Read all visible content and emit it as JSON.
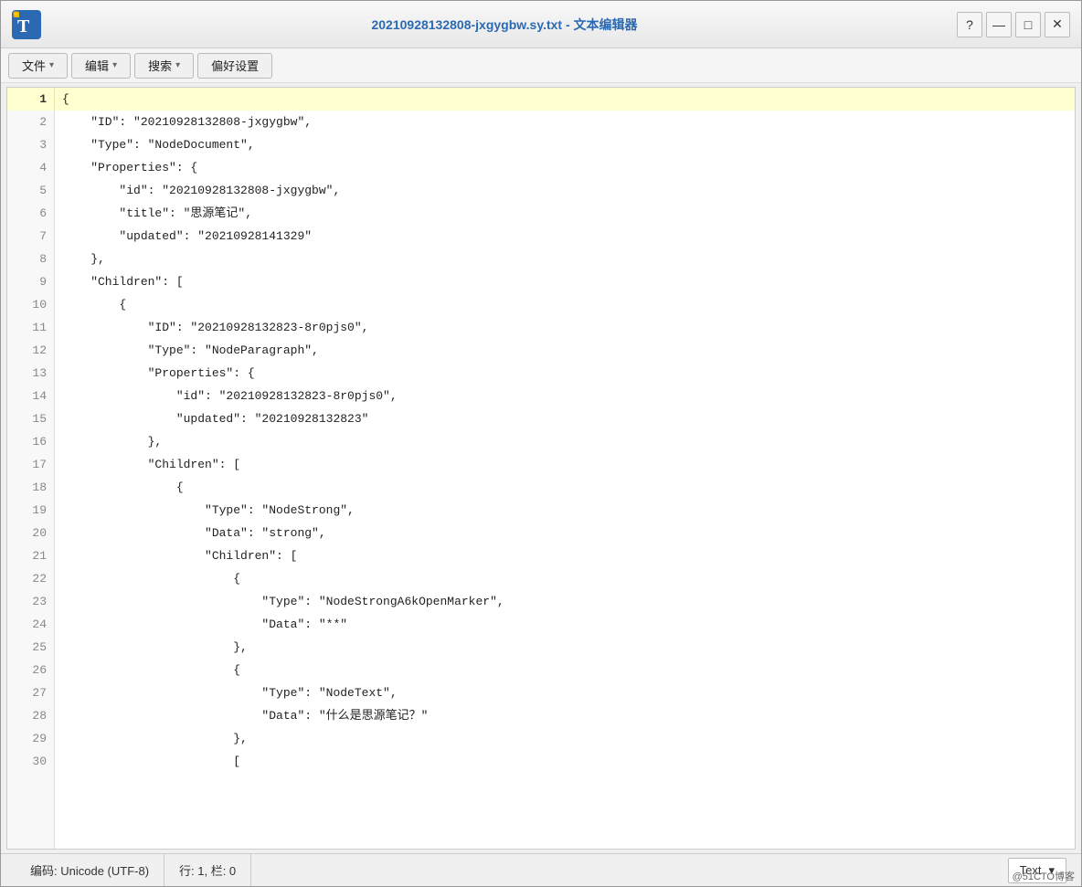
{
  "window": {
    "title": "20210928132808-jxgygbw.sy.txt - 文本编辑器",
    "icon_label": "T"
  },
  "title_controls": {
    "help": "?",
    "minimize": "—",
    "maximize": "□",
    "close": "✕"
  },
  "menu": {
    "file_label": "文件",
    "file_arrow": "▾",
    "edit_label": "编辑",
    "edit_arrow": "▾",
    "search_label": "搜索",
    "search_arrow": "▾",
    "preferences_label": "偏好设置"
  },
  "lines": [
    {
      "num": 1,
      "active": true,
      "text": "{"
    },
    {
      "num": 2,
      "active": false,
      "text": "    \"ID\": \"20210928132808-jxgygbw\","
    },
    {
      "num": 3,
      "active": false,
      "text": "    \"Type\": \"NodeDocument\","
    },
    {
      "num": 4,
      "active": false,
      "text": "    \"Properties\": {"
    },
    {
      "num": 5,
      "active": false,
      "text": "        \"id\": \"20210928132808-jxgygbw\","
    },
    {
      "num": 6,
      "active": false,
      "text": "        \"title\": \"思源笔记\","
    },
    {
      "num": 7,
      "active": false,
      "text": "        \"updated\": \"20210928141329\""
    },
    {
      "num": 8,
      "active": false,
      "text": "    },"
    },
    {
      "num": 9,
      "active": false,
      "text": "    \"Children\": ["
    },
    {
      "num": 10,
      "active": false,
      "text": "        {"
    },
    {
      "num": 11,
      "active": false,
      "text": "            \"ID\": \"20210928132823-8r0pjs0\","
    },
    {
      "num": 12,
      "active": false,
      "text": "            \"Type\": \"NodeParagraph\","
    },
    {
      "num": 13,
      "active": false,
      "text": "            \"Properties\": {"
    },
    {
      "num": 14,
      "active": false,
      "text": "                \"id\": \"20210928132823-8r0pjs0\","
    },
    {
      "num": 15,
      "active": false,
      "text": "                \"updated\": \"20210928132823\""
    },
    {
      "num": 16,
      "active": false,
      "text": "            },"
    },
    {
      "num": 17,
      "active": false,
      "text": "            \"Children\": ["
    },
    {
      "num": 18,
      "active": false,
      "text": "                {"
    },
    {
      "num": 19,
      "active": false,
      "text": "                    \"Type\": \"NodeStrong\","
    },
    {
      "num": 20,
      "active": false,
      "text": "                    \"Data\": \"strong\","
    },
    {
      "num": 21,
      "active": false,
      "text": "                    \"Children\": ["
    },
    {
      "num": 22,
      "active": false,
      "text": "                        {"
    },
    {
      "num": 23,
      "active": false,
      "text": "                            \"Type\": \"NodeStrongA6kOpenMarker\","
    },
    {
      "num": 24,
      "active": false,
      "text": "                            \"Data\": \"**\""
    },
    {
      "num": 25,
      "active": false,
      "text": "                        },"
    },
    {
      "num": 26,
      "active": false,
      "text": "                        {"
    },
    {
      "num": 27,
      "active": false,
      "text": "                            \"Type\": \"NodeText\","
    },
    {
      "num": 28,
      "active": false,
      "text": "                            \"Data\": \"什么是思源笔记？\""
    },
    {
      "num": 29,
      "active": false,
      "text": "                        },"
    },
    {
      "num": 30,
      "active": false,
      "text": "                        ["
    }
  ],
  "status": {
    "encoding": "编码: Unicode (UTF-8)",
    "position": "行: 1, 栏: 0",
    "mode": "Text",
    "dropdown_arrow": "▾"
  },
  "watermark": "@51CTO博客"
}
